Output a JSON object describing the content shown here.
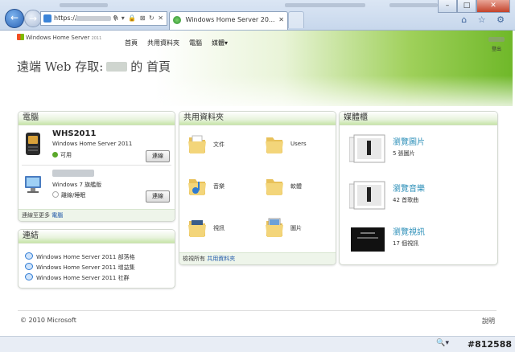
{
  "browser": {
    "address_prefix": "https://",
    "address_suffix": "h",
    "address_icons": "⚲ ▾ 🔒 ⊠ ↻ ✕",
    "tab_title": "Windows Home Server 20...",
    "tab_close": "✕",
    "back": "←",
    "forward": "→",
    "window_controls": [
      "–",
      "□",
      "✕"
    ],
    "tools_icons": "⌂ ☆ ⚙"
  },
  "header": {
    "logo_text": "Windows Home Server",
    "logo_suffix": "2011",
    "nav": [
      "首頁",
      "共用資料夾",
      "電腦",
      "媒體"
    ],
    "nav_dropdown_arrow": "▾",
    "user_sub": "登出",
    "title_prefix": "遠端 Web 存取:",
    "title_suffix": "的 首頁"
  },
  "computers": {
    "heading": "電腦",
    "items": [
      {
        "name": "WHS2011",
        "os": "Windows Home Server 2011",
        "status": "可用",
        "status_color": "#5aa82a",
        "button": "連線"
      },
      {
        "name": "",
        "os": "Windows 7 旗艦版",
        "status": "離線/睡眠",
        "status_color": "#bdbdbd",
        "button": "連線"
      }
    ],
    "footer_prefix": "連線至更多",
    "footer_link": "電腦"
  },
  "links": {
    "heading": "連結",
    "items": [
      "Windows Home Server 2011 部落格",
      "Windows Home Server 2011 增益集",
      "Windows Home Server 2011 社群"
    ]
  },
  "folders": {
    "heading": "共用資料夾",
    "items": [
      {
        "label": "文件",
        "icon": "documents-folder"
      },
      {
        "label": "Users",
        "icon": "users-folder"
      },
      {
        "label": "音樂",
        "icon": "music-folder"
      },
      {
        "label": "軟體",
        "icon": "software-folder"
      },
      {
        "label": "視訊",
        "icon": "videos-folder"
      },
      {
        "label": "圖片",
        "icon": "pictures-folder"
      }
    ],
    "footer_prefix": "檢視所有",
    "footer_link": "共用資料夾"
  },
  "media": {
    "heading": "媒體櫃",
    "items": [
      {
        "title": "瀏覽圖片",
        "count": "5 張圖片"
      },
      {
        "title": "瀏覽音樂",
        "count": "42 首歌曲"
      },
      {
        "title": "瀏覽視訊",
        "count": "17 個視訊"
      }
    ]
  },
  "footer": {
    "copyright": "© 2010 Microsoft",
    "help": "說明"
  },
  "status": {
    "watermark": "#812588",
    "zoom_icon": "🔍▾"
  },
  "colors": {
    "accent_green": "#6fb829",
    "link_blue": "#1d56a8",
    "media_title": "#2c8fb8"
  }
}
